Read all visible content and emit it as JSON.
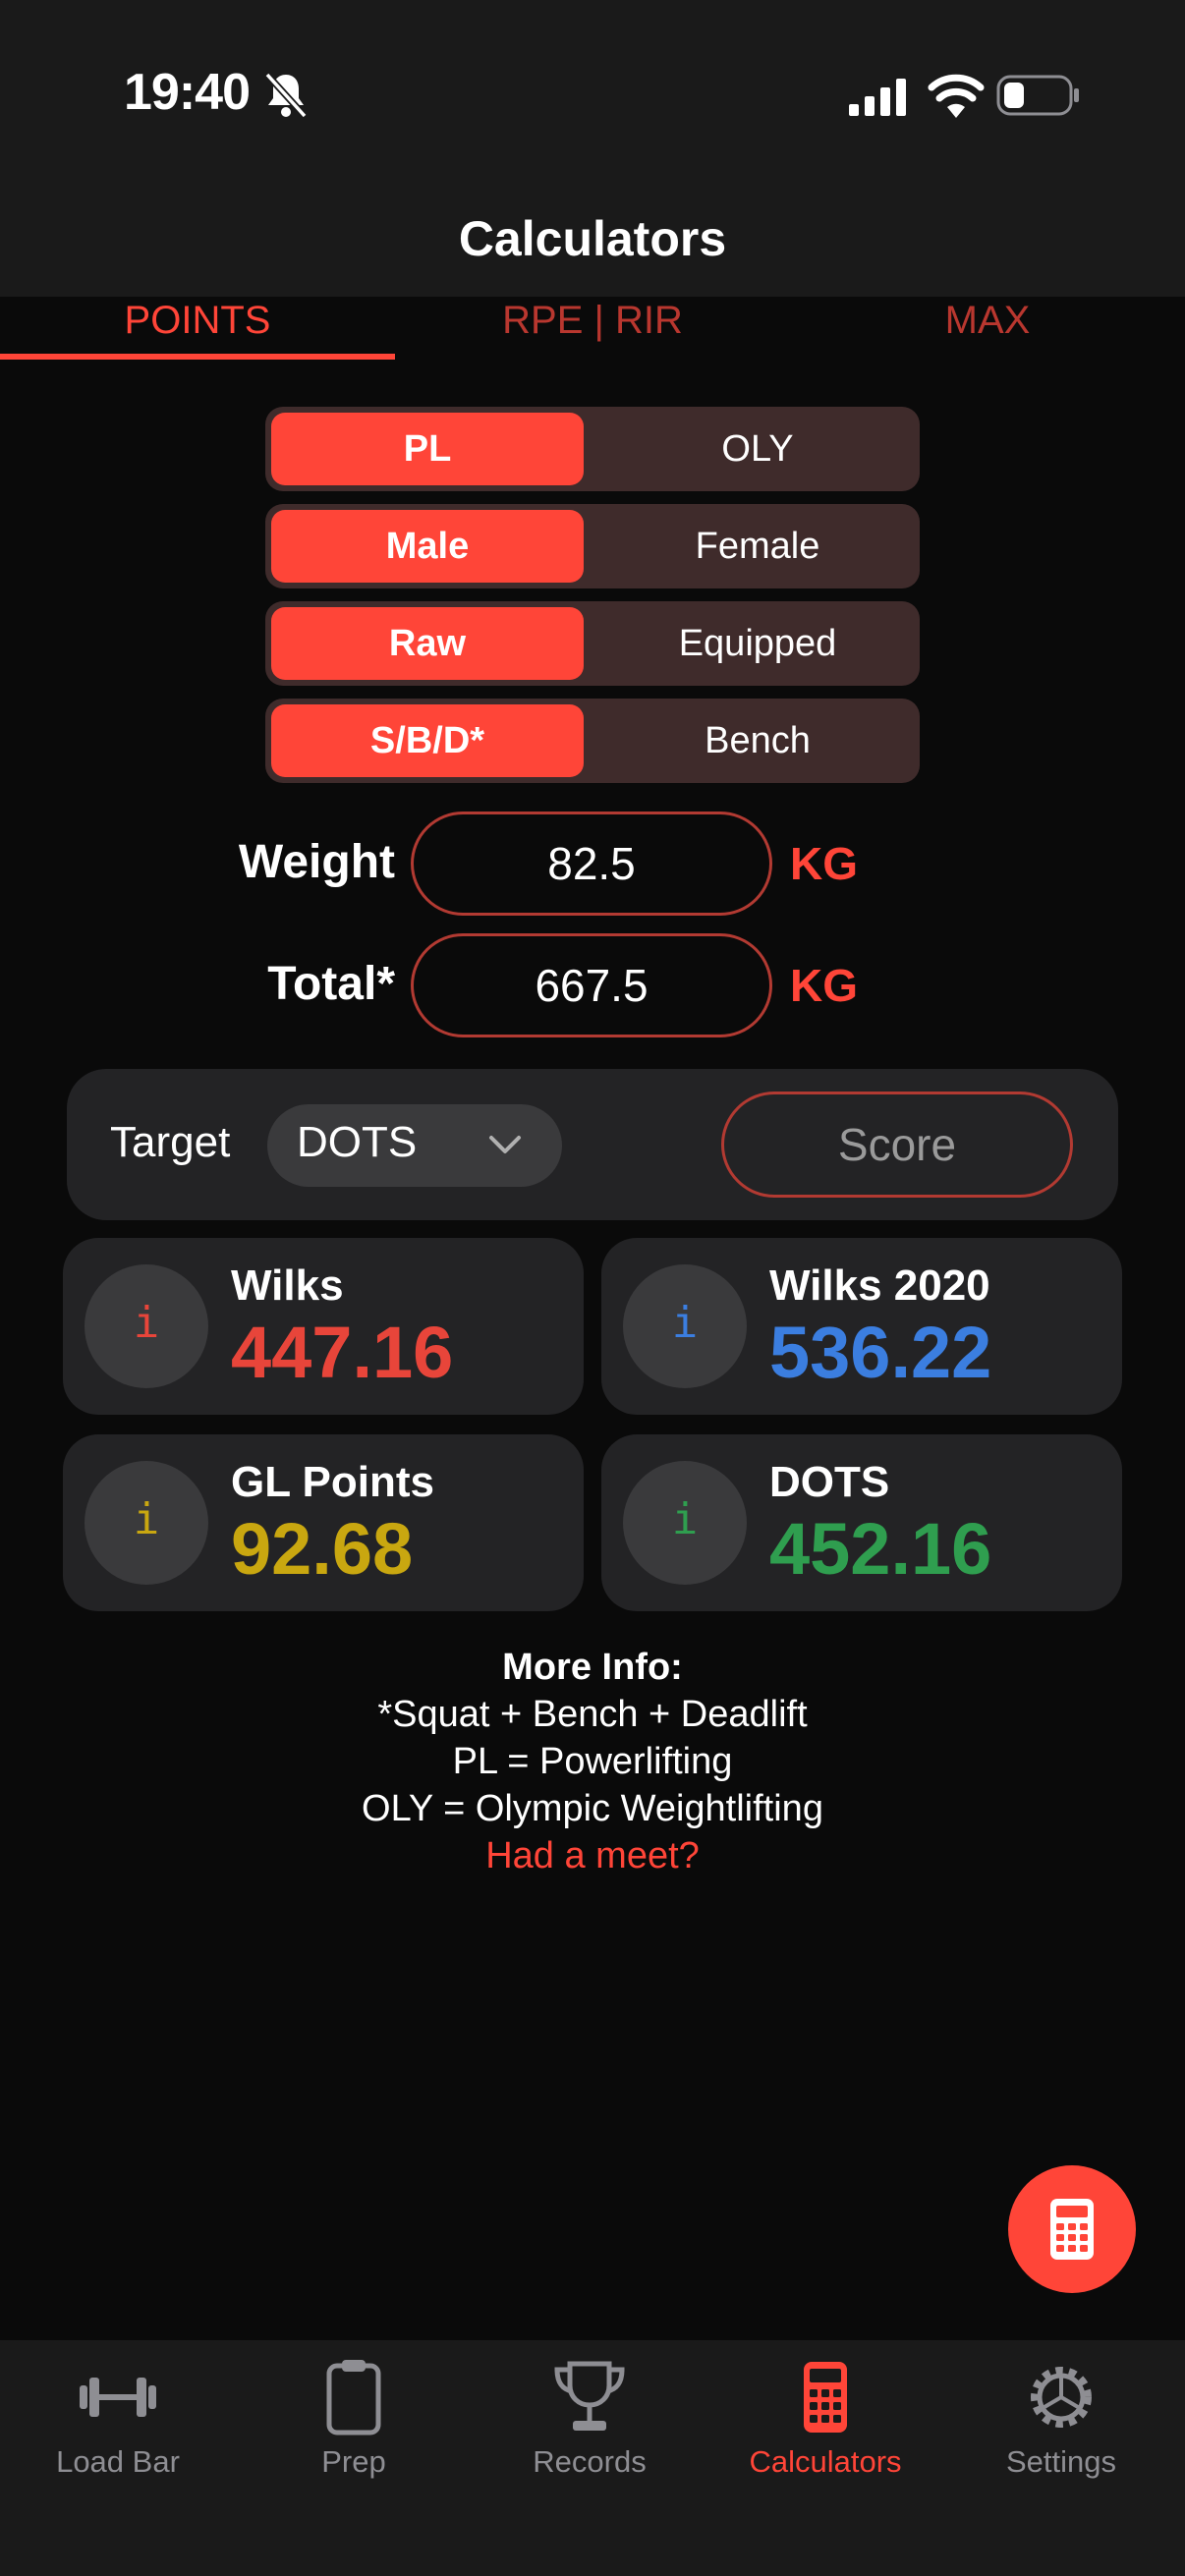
{
  "status_bar": {
    "time": "19:40"
  },
  "header": {
    "title": "Calculators"
  },
  "tabs": [
    {
      "label": "POINTS"
    },
    {
      "label": "RPE | RIR"
    },
    {
      "label": "MAX"
    }
  ],
  "segments": [
    {
      "left": "PL",
      "right": "OLY"
    },
    {
      "left": "Male",
      "right": "Female"
    },
    {
      "left": "Raw",
      "right": "Equipped"
    },
    {
      "left": "S/B/D*",
      "right": "Bench"
    }
  ],
  "inputs": {
    "weight": {
      "label": "Weight",
      "value": "82.5",
      "unit": "KG"
    },
    "total": {
      "label": "Total*",
      "value": "667.5",
      "unit": "KG"
    }
  },
  "target": {
    "label": "Target",
    "value": "DOTS",
    "score_label": "Score"
  },
  "results": [
    {
      "name": "Wilks",
      "value": "447.16",
      "color": "#e8453a",
      "icon": "info-icon"
    },
    {
      "name": "Wilks 2020",
      "value": "536.22",
      "color": "#3b7ee0",
      "icon": "info-icon"
    },
    {
      "name": "GL Points",
      "value": "92.68",
      "color": "#c9a710",
      "icon": "info-icon"
    },
    {
      "name": "DOTS",
      "value": "452.16",
      "color": "#2f9e4f",
      "icon": "info-icon"
    }
  ],
  "info_icon_glyph": "i",
  "more_info": {
    "heading": "More Info:",
    "lines": [
      "*Squat + Bench + Deadlift",
      "PL = Powerlifting",
      "OLY = Olympic Weightlifting"
    ],
    "link": "Had a meet?"
  },
  "nav": [
    {
      "label": "Load Bar",
      "icon": "barbell-icon"
    },
    {
      "label": "Prep",
      "icon": "clipboard-icon"
    },
    {
      "label": "Records",
      "icon": "trophy-icon"
    },
    {
      "label": "Calculators",
      "icon": "calculator-icon",
      "active": true
    },
    {
      "label": "Settings",
      "icon": "gear-icon"
    }
  ],
  "colors": {
    "accent": "#ff4538",
    "segment_bg": "#3f2b2b",
    "card_bg": "#232325"
  }
}
